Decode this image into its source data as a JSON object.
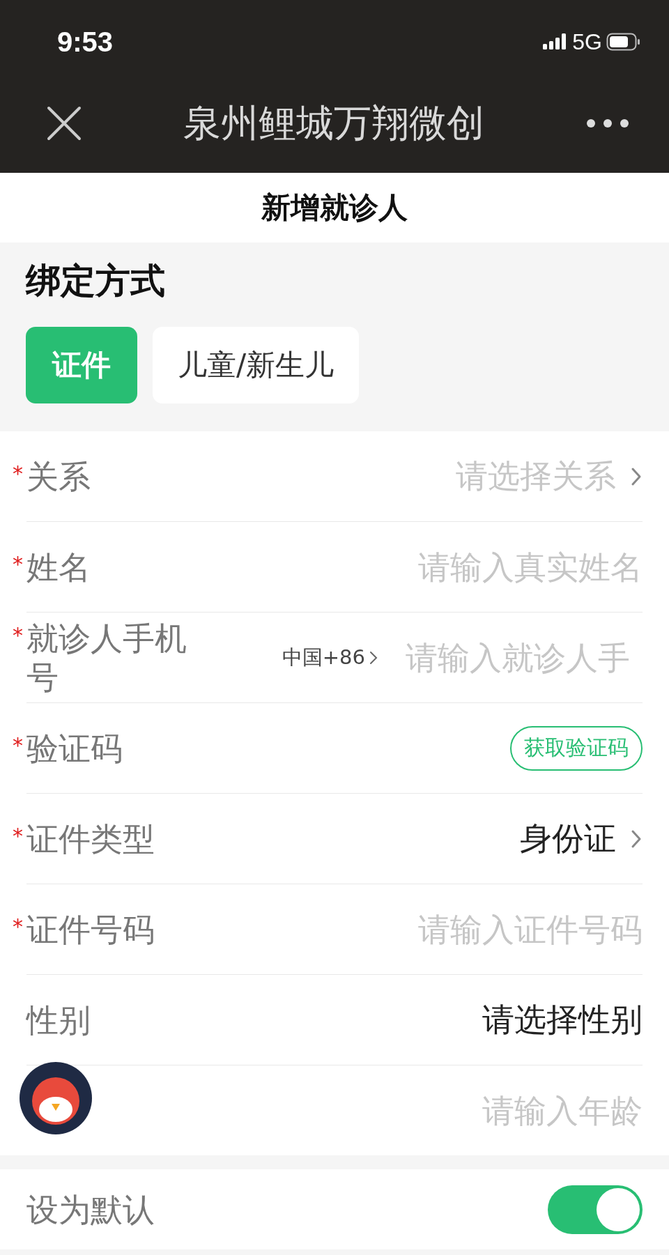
{
  "status_bar": {
    "time": "9:53",
    "network": "5G"
  },
  "nav_bar": {
    "title": "泉州鲤城万翔微创"
  },
  "page_title": "新增就诊人",
  "binding": {
    "heading": "绑定方式",
    "tabs": [
      {
        "label": "证件",
        "selected": true
      },
      {
        "label": "儿童/新生儿",
        "selected": false
      }
    ]
  },
  "fields": [
    {
      "kind": "select",
      "required_mark": "*",
      "label": "关系",
      "placeholder": "请选择关系"
    },
    {
      "kind": "input",
      "required_mark": "*",
      "label": "姓名",
      "placeholder": "请输入真实姓名"
    },
    {
      "kind": "phone",
      "required_mark": "*",
      "label": "就诊人手机号",
      "prefix": "中国+86",
      "placeholder": "请输入就诊人手"
    },
    {
      "kind": "code",
      "required_mark": "*",
      "label": "验证码",
      "button": "获取验证码"
    },
    {
      "kind": "select",
      "required_mark": "*",
      "label": "证件类型",
      "value": "身份证"
    },
    {
      "kind": "input",
      "required_mark": "*",
      "label": "证件号码",
      "placeholder": "请输入证件号码"
    },
    {
      "kind": "value",
      "label": "性别",
      "value": "请选择性别"
    },
    {
      "kind": "input",
      "placeholder": "请输入年龄"
    }
  ],
  "default_setting": {
    "label": "设为默认",
    "on": true
  }
}
